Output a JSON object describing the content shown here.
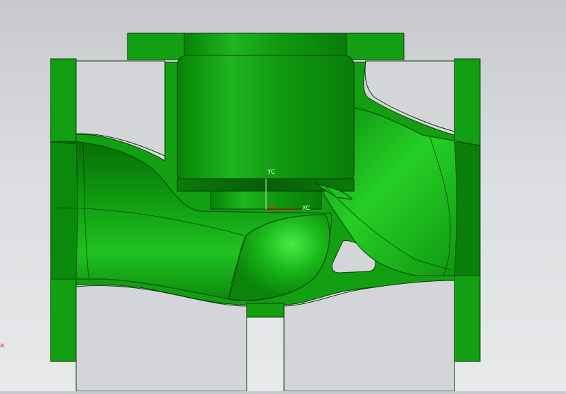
{
  "viewport": {
    "background_top": "#c7c9cc",
    "background_bottom": "#e8e9eb",
    "model_color": "#12a012",
    "model_highlight": "#3ee63e",
    "model_shadow": "#056905",
    "edge_color": "#063d06"
  },
  "csys": {
    "y_axis_label": "YC",
    "x_axis_label": "XC",
    "z_axis_label": "ZC",
    "y_axis_color": "#d8e8d8",
    "x_axis_color": "#e02020"
  },
  "marker": {
    "symbol": "×"
  }
}
